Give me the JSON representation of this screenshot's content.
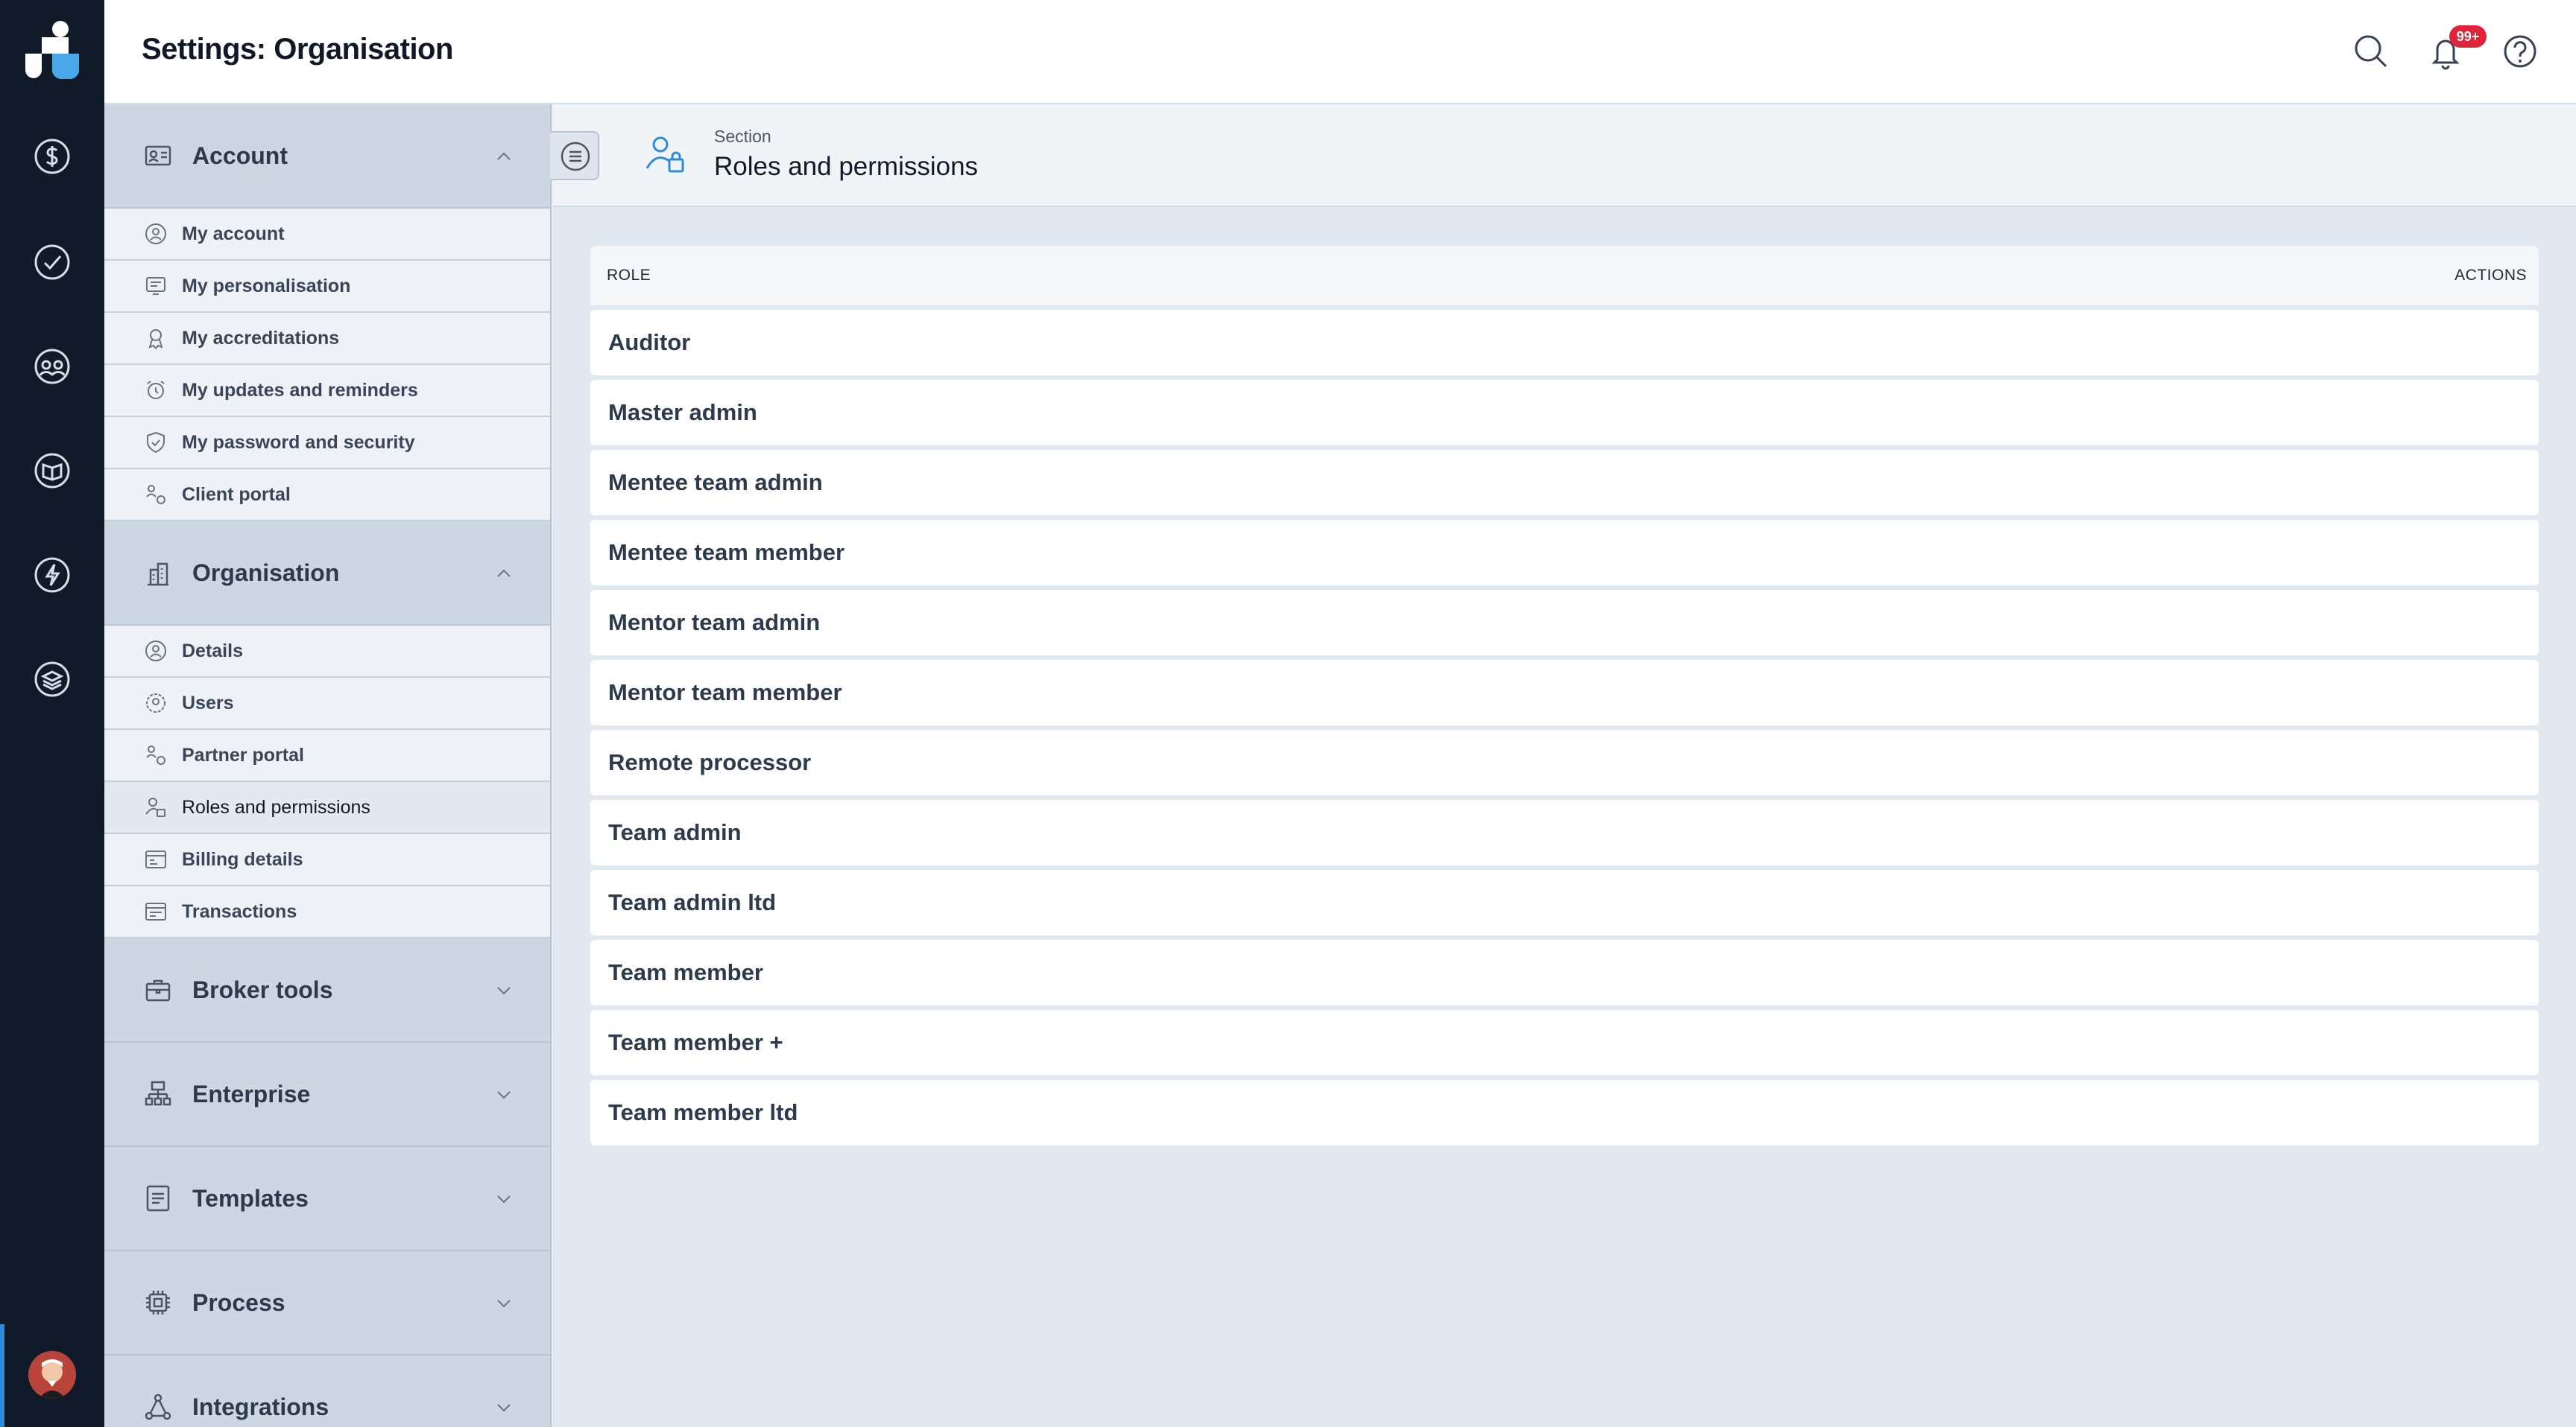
{
  "header": {
    "title": "Settings: Organisation",
    "notifications_badge": "99+"
  },
  "rail": {
    "items": [
      "dollar-icon",
      "check-circle-icon",
      "team-icon",
      "book-icon",
      "bolt-icon",
      "layers-icon"
    ]
  },
  "sidebar": {
    "account": {
      "label": "Account",
      "items": [
        {
          "label": "My account",
          "icon": "user-circle-icon"
        },
        {
          "label": "My personalisation",
          "icon": "personalisation-icon"
        },
        {
          "label": "My accreditations",
          "icon": "accreditation-icon"
        },
        {
          "label": "My updates and reminders",
          "icon": "alarm-icon"
        },
        {
          "label": "My password and security",
          "icon": "shield-icon"
        },
        {
          "label": "Client portal",
          "icon": "portal-icon"
        }
      ]
    },
    "organisation": {
      "label": "Organisation",
      "items": [
        {
          "label": "Details",
          "icon": "details-icon"
        },
        {
          "label": "Users",
          "icon": "users-icon"
        },
        {
          "label": "Partner portal",
          "icon": "portal-icon"
        },
        {
          "label": "Roles and permissions",
          "icon": "user-lock-icon"
        },
        {
          "label": "Billing details",
          "icon": "billing-icon"
        },
        {
          "label": "Transactions",
          "icon": "transactions-icon"
        }
      ]
    },
    "collapsed_groups": [
      {
        "label": "Broker tools",
        "icon": "briefcase-icon"
      },
      {
        "label": "Enterprise",
        "icon": "hierarchy-icon"
      },
      {
        "label": "Templates",
        "icon": "document-icon"
      },
      {
        "label": "Process",
        "icon": "chip-icon"
      },
      {
        "label": "Integrations",
        "icon": "network-icon"
      }
    ]
  },
  "section": {
    "kicker": "Section",
    "title": "Roles and permissions"
  },
  "table": {
    "col_role": "ROLE",
    "col_actions": "ACTIONS",
    "rows": [
      "Auditor",
      "Master admin",
      "Mentee team admin",
      "Mentee team member",
      "Mentor team admin",
      "Mentor team member",
      "Remote processor",
      "Team admin",
      "Team admin ltd",
      "Team member",
      "Team member +",
      "Team member ltd"
    ]
  },
  "colors": {
    "rail_bg": "#111a29",
    "accent": "#2d8cd8",
    "badge": "#e0243b"
  }
}
